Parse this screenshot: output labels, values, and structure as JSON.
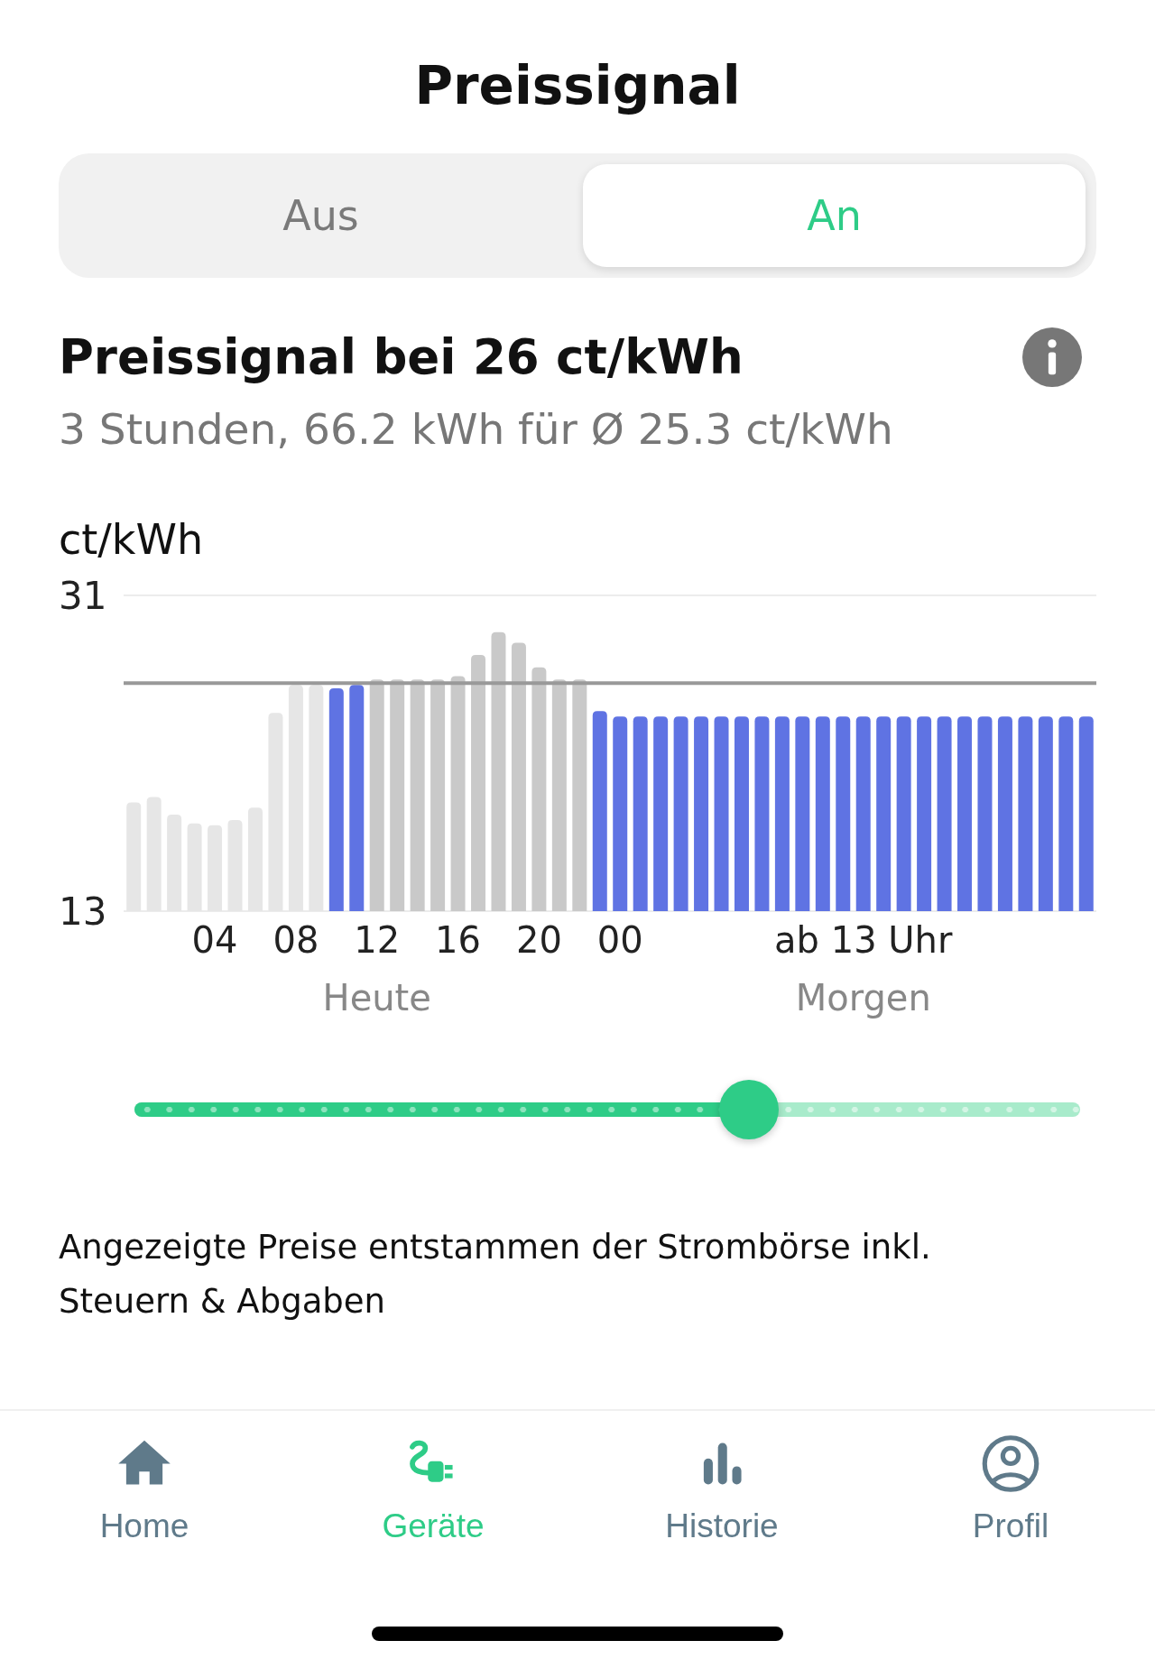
{
  "title": "Preissignal",
  "mode_tabs": [
    {
      "label": "Aus",
      "selected": false
    },
    {
      "label": "An",
      "selected": true
    }
  ],
  "signal": {
    "heading": "Preissignal bei 26 ct/kWh",
    "summary": "3 Stunden, 66.2 kWh für Ø 25.3 ct/kWh"
  },
  "chart": {
    "chart_data": {
      "type": "bar",
      "ylabel": "ct/kWh",
      "ylim": [
        13,
        31
      ],
      "yticks": [
        13,
        31
      ],
      "categories": [
        null,
        null,
        null,
        null,
        "04",
        null,
        null,
        null,
        "08",
        null,
        null,
        null,
        "12",
        null,
        null,
        null,
        "16",
        null,
        null,
        null,
        "20",
        null,
        null,
        null,
        "00",
        null,
        null,
        null,
        null,
        null,
        null,
        null,
        null,
        null,
        null,
        null,
        "ab 13 Uhr",
        null,
        null,
        null,
        null,
        null,
        null,
        null,
        null,
        null,
        null,
        null
      ],
      "series": [
        {
          "color": "#e6e6e6",
          "values": [
            19.2,
            19.5,
            18.5,
            18.0,
            17.9,
            18.2,
            18.9,
            24.3,
            25.9,
            25.9,
            null,
            null,
            null,
            null,
            null,
            null,
            null,
            null,
            null,
            null,
            null,
            null,
            null,
            null,
            null,
            null,
            null,
            null,
            null,
            null,
            null,
            null,
            null,
            null,
            null,
            null,
            null,
            null,
            null,
            null,
            null,
            null,
            null,
            null,
            null,
            null,
            null,
            null
          ]
        },
        {
          "color": "#5f73e3",
          "values": [
            null,
            null,
            null,
            null,
            null,
            null,
            null,
            null,
            null,
            null,
            25.7,
            25.9,
            null,
            null,
            null,
            null,
            null,
            null,
            null,
            null,
            null,
            null,
            null,
            24.4,
            24.1,
            24.1,
            24.1,
            24.1,
            24.1,
            24.1,
            24.1,
            24.1,
            24.1,
            24.1,
            24.1,
            24.1,
            24.1,
            24.1,
            24.1,
            24.1,
            24.1,
            24.1,
            24.1,
            24.1,
            24.1,
            24.1,
            24.1,
            24.1
          ]
        },
        {
          "color": "#c9c9c9",
          "values": [
            null,
            null,
            null,
            null,
            null,
            null,
            null,
            null,
            null,
            null,
            null,
            null,
            26.2,
            26.2,
            26.2,
            26.2,
            26.4,
            27.6,
            28.9,
            28.3,
            26.9,
            26.2,
            26.2,
            null,
            null,
            null,
            null,
            null,
            null,
            null,
            null,
            null,
            null,
            null,
            null,
            null,
            null,
            null,
            null,
            null,
            null,
            null,
            null,
            null,
            null,
            null,
            null,
            null
          ]
        }
      ],
      "ref_lines": [
        {
          "axis": "y",
          "value": 26
        }
      ]
    },
    "day_labels": [
      "Heute",
      "Morgen"
    ]
  },
  "time_slider": {
    "level": 0.65
  },
  "footnote": "Angezeigte Preise entstammen der Strombörse inkl. Steuern & Abgaben",
  "nav": [
    {
      "kind": "home",
      "label": "Home",
      "selected": false
    },
    {
      "kind": "plug",
      "label": "Geräte",
      "selected": true
    },
    {
      "kind": "stats",
      "label": "Historie",
      "selected": false
    },
    {
      "kind": "profile",
      "label": "Profil",
      "selected": false
    }
  ]
}
